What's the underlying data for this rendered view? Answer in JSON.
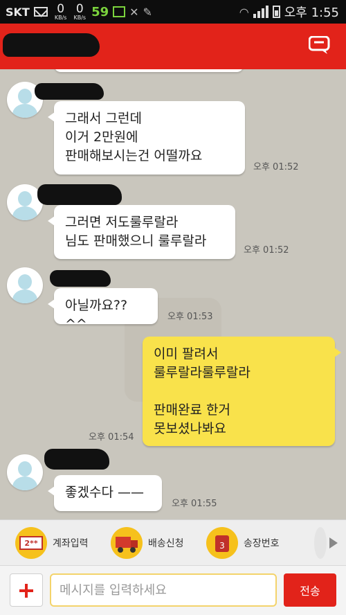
{
  "status_bar": {
    "carrier": "SKT",
    "down_speed": "0",
    "down_unit": "KB/s",
    "up_speed": "0",
    "up_unit": "KB/s",
    "badge_number": "59",
    "time": "오후 1:55"
  },
  "messages": [
    {
      "text": "그래서 그런데\n이거 2만원에\n판매해보시는건 어떨까요",
      "time": "오후 01:52",
      "sender": "other"
    },
    {
      "text": "그러면 저도룰루랄라\n님도 판매했으니 룰루랄라",
      "time": "오후 01:52",
      "sender": "other"
    },
    {
      "text": "아닐까요??^^",
      "time": "오후 01:53",
      "sender": "other"
    },
    {
      "text": "이미 팔려서\n룰루랄라룰루랄라\n\n판매완료 한거\n못보셨나봐요",
      "time": "오후 01:54",
      "sender": "me"
    },
    {
      "text": "좋겠수다 ——",
      "time": "오후 01:55",
      "sender": "other"
    }
  ],
  "actions": [
    {
      "label": "계좌입력",
      "icon": "bank-card-icon",
      "icon_text": "2**"
    },
    {
      "label": "배송신청",
      "icon": "delivery-truck-icon"
    },
    {
      "label": "송장번호",
      "icon": "invoice-tag-icon",
      "icon_text": "3"
    }
  ],
  "input": {
    "placeholder": "메시지를 입력하세요",
    "value": "",
    "send_label": "전송"
  },
  "colors": {
    "header_red": "#e2231a",
    "my_bubble": "#f9e24b",
    "their_bubble": "#ffffff",
    "chat_background": "#c9c6bd",
    "action_icon_yellow": "#f6c11c"
  }
}
